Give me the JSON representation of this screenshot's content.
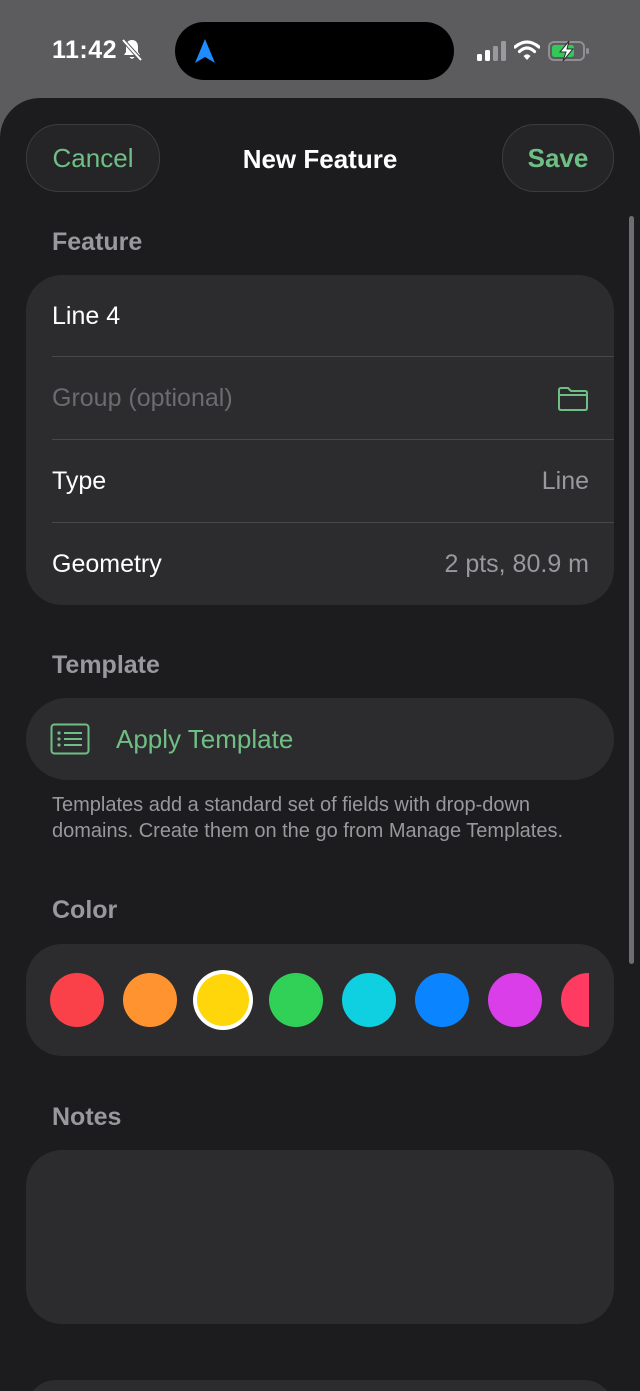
{
  "status_bar": {
    "time": "11:42"
  },
  "header": {
    "cancel_label": "Cancel",
    "title": "New Feature",
    "save_label": "Save"
  },
  "feature_section": {
    "label": "Feature",
    "name_value": "Line 4",
    "group_placeholder": "Group (optional)",
    "type_label": "Type",
    "type_value": "Line",
    "geometry_label": "Geometry",
    "geometry_value": "2 pts, 80.9 m"
  },
  "template_section": {
    "label": "Template",
    "apply_label": "Apply Template",
    "helper_text": "Templates add a standard set of fields with drop-down domains. Create them on the go from Manage Templates."
  },
  "color_section": {
    "label": "Color",
    "swatches": [
      "#fa4149",
      "#ff9330",
      "#ffd60a",
      "#31d158",
      "#0fd0e0",
      "#0a84ff",
      "#d93ee8",
      "#ff3b61"
    ],
    "selected_index": 2
  },
  "notes_section": {
    "label": "Notes",
    "value": ""
  },
  "colors": {
    "accent": "#6fbf85",
    "sheet_bg": "#1c1c1e",
    "card_bg": "#2c2c2e"
  }
}
